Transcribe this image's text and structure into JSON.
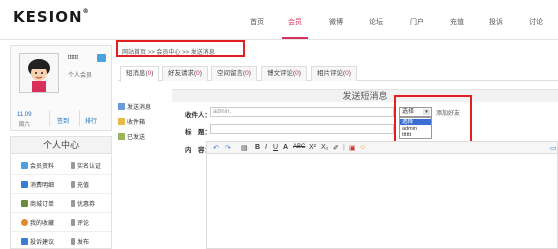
{
  "logo": {
    "text": "KESION",
    "mark": "®"
  },
  "nav": {
    "items": [
      "首页",
      "会员",
      "微博",
      "论坛",
      "门户",
      "充值",
      "投诉",
      "讨论"
    ],
    "active": "会员"
  },
  "profile": {
    "username": "tttttt",
    "role": "个人会员",
    "date": "11.09",
    "weekday": "周六",
    "sign": "签到",
    "rank": "排行"
  },
  "user_center": {
    "title": "个人中心",
    "menu": [
      [
        "会员资料",
        "实名认证"
      ],
      [
        "消费明细",
        "充值"
      ],
      [
        "商城订单",
        "优惠券"
      ],
      [
        "我的收藏",
        "评论"
      ],
      [
        "投诉建议",
        "发布"
      ]
    ]
  },
  "breadcrumb": {
    "home": "网站首页",
    "sep": ">>",
    "center": "会员中心",
    "current": "发送消息"
  },
  "tabs": [
    {
      "label": "短消息",
      "count": "0"
    },
    {
      "label": "好友请求",
      "count": "0"
    },
    {
      "label": "空间留言",
      "count": "0"
    },
    {
      "label": "博文评论",
      "count": "0"
    },
    {
      "label": "相片评论",
      "count": "0"
    }
  ],
  "subnav": [
    "发送消息",
    "收件箱",
    "已发送"
  ],
  "compose": {
    "title": "发送短消息",
    "recipient_label": "收件人：",
    "recipient_value": "admin,",
    "subject_label": "标　题：",
    "content_label": "内　容：",
    "select_value": "选择",
    "options": [
      "选择",
      "admin",
      "tttttt"
    ],
    "add_friend": "添加好友"
  },
  "colors": {
    "accent": "#d9305b",
    "link": "#1a6fba",
    "highlight": "#e02020"
  }
}
